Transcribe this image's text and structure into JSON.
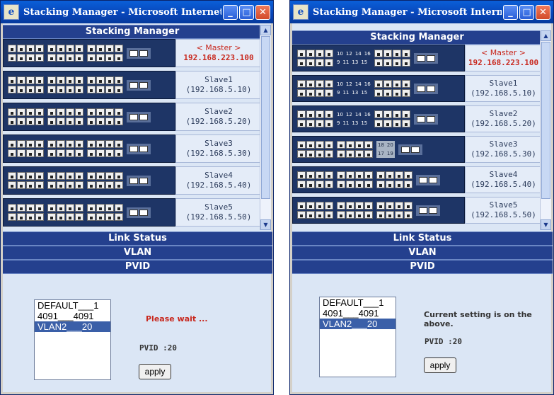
{
  "left": {
    "title": "Stacking Manager - Microsoft Internet Explorer",
    "panel": "Stacking Manager",
    "units": [
      {
        "name": "< Master >",
        "ip": "192.168.223.100",
        "master": true
      },
      {
        "name": "Slave1",
        "ip": "(192.168.5.10)"
      },
      {
        "name": "Slave2",
        "ip": "(192.168.5.20)"
      },
      {
        "name": "Slave3",
        "ip": "(192.168.5.30)"
      },
      {
        "name": "Slave4",
        "ip": "(192.168.5.40)"
      },
      {
        "name": "Slave5",
        "ip": "(192.168.5.50)"
      }
    ],
    "menu": {
      "link_status": "Link Status",
      "vlan": "VLAN",
      "pvid": "PVID"
    },
    "vlan_list": [
      "DEFAULT___1",
      "4091___4091",
      "VLAN2___20"
    ],
    "selected_index": 2,
    "message": "Please wait ...",
    "message_color": "#c8281e",
    "pvid_text": "PVID :20",
    "apply_label": "apply"
  },
  "right": {
    "title": "Stacking Manager - Microsoft Internet Explorer",
    "panel": "Stacking Manager",
    "units": [
      {
        "name": "< Master >",
        "ip": "192.168.223.100",
        "master": true
      },
      {
        "name": "Slave1",
        "ip": "(192.168.5.10)"
      },
      {
        "name": "Slave2",
        "ip": "(192.168.5.20)"
      },
      {
        "name": "Slave3",
        "ip": "(192.168.5.30)"
      },
      {
        "name": "Slave4",
        "ip": "(192.168.5.40)"
      },
      {
        "name": "Slave5",
        "ip": "(192.168.5.50)"
      }
    ],
    "port_numbers": {
      "top": [
        "10",
        "12",
        "14",
        "16"
      ],
      "bottom": [
        "9",
        "11",
        "13",
        "15"
      ],
      "top_b": [
        "18",
        "20"
      ],
      "bottom_b": [
        "17",
        "19"
      ]
    },
    "menu": {
      "link_status": "Link Status",
      "vlan": "VLAN",
      "pvid": "PVID"
    },
    "vlan_list": [
      "DEFAULT___1",
      "4091___4091",
      "VLAN2___20"
    ],
    "selected_index": 2,
    "message": "Current setting is on the above.",
    "message_color": "#333333",
    "pvid_text": "PVID :20",
    "apply_label": "apply"
  },
  "icons": {
    "ie": "ie-logo-icon",
    "minimize": "minimize-icon",
    "maximize": "maximize-icon",
    "close": "close-icon"
  }
}
